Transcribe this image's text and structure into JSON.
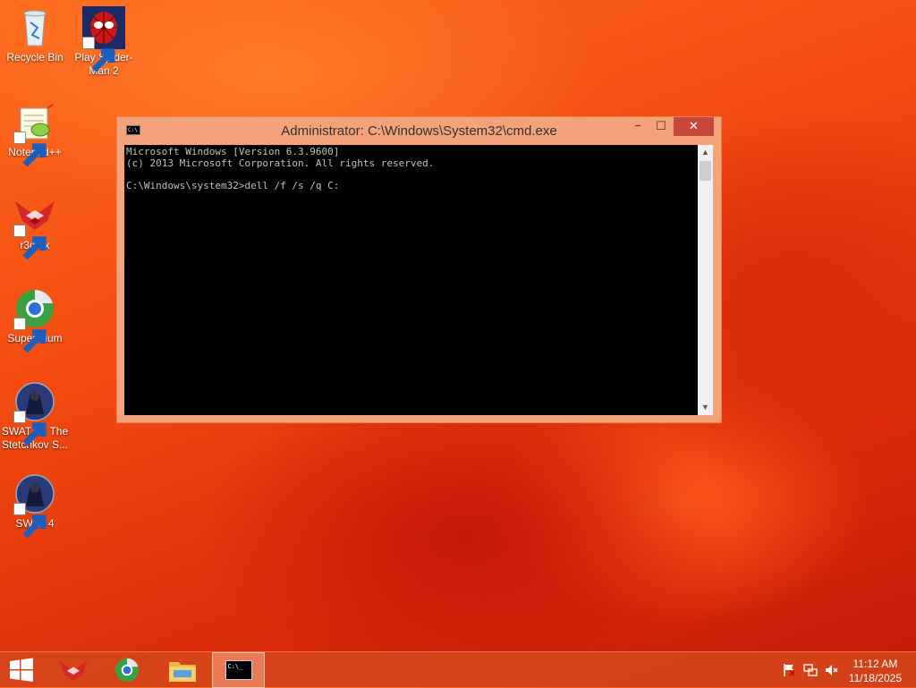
{
  "desktop": {
    "icons": [
      {
        "label": "Recycle Bin"
      },
      {
        "label": "Play Spider-Man 2"
      },
      {
        "label": "Notepad++"
      },
      {
        "label": "r3dfox"
      },
      {
        "label": "Supermium"
      },
      {
        "label": "SWAT 4 - The Stetchkov S..."
      },
      {
        "label": "SWAT 4"
      }
    ]
  },
  "window": {
    "title": "Administrator: C:\\Windows\\System32\\cmd.exe",
    "title_icon_text": "C:\\",
    "minimize": "−",
    "maximize": "☐",
    "close": "✕",
    "console_lines": [
      "Microsoft Windows [Version 6.3.9600]",
      "(c) 2013 Microsoft Corporation. All rights reserved.",
      "",
      "C:\\Windows\\system32>dell /f /s /q C:"
    ]
  },
  "taskbar": {
    "items": [
      {
        "icon": "windows-start-icon"
      },
      {
        "icon": "r3dfox-icon"
      },
      {
        "icon": "supermium-icon"
      },
      {
        "icon": "file-explorer-icon"
      },
      {
        "icon": "cmd-icon",
        "active": true
      }
    ],
    "cmd_icon_text": "C:\\_",
    "clock_time": "11:12 AM",
    "clock_date": "11/18/2025"
  },
  "colors": {
    "title_bar": "#f3a27a",
    "close_button": "#c7473a",
    "console_bg": "#000000",
    "console_text": "#c0c0c0"
  }
}
